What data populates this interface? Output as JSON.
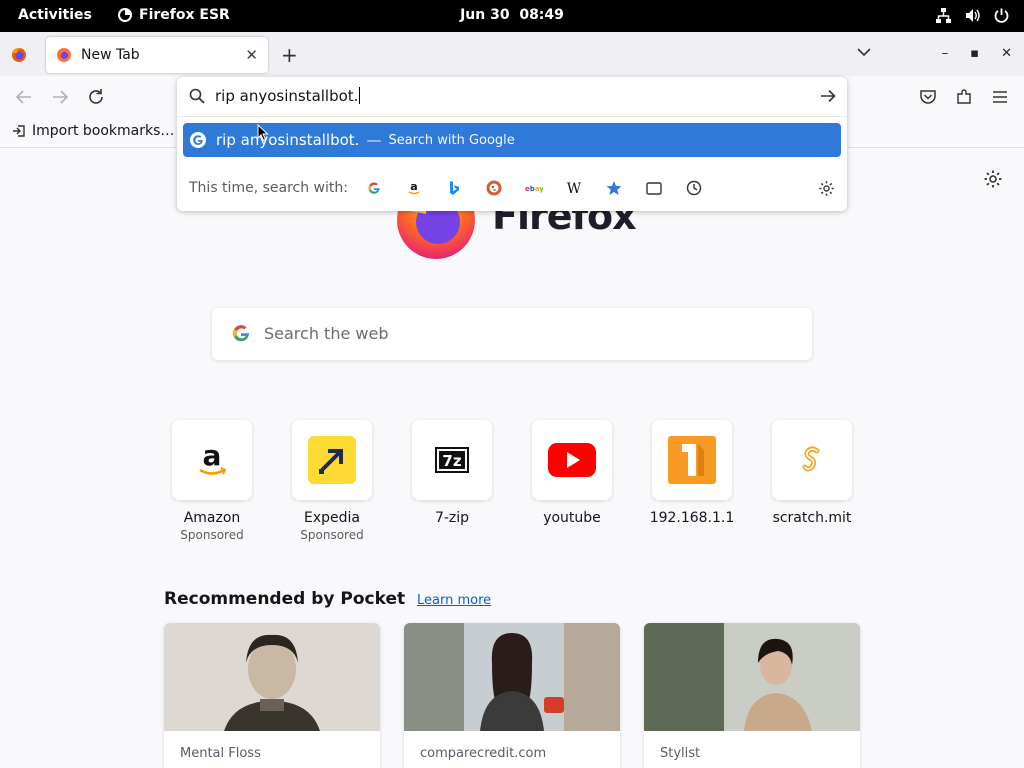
{
  "system_bar": {
    "activities": "Activities",
    "app_name": "Firefox ESR",
    "date": "Jun 30",
    "time": "08:49"
  },
  "tabs": [
    {
      "title": "New Tab",
      "active": true
    }
  ],
  "bookmarks_toolbar": {
    "import_label": "Import bookmarks…"
  },
  "urlbar": {
    "value": "rip anyosinstallbot.",
    "suggestion": {
      "query": "rip anyosinstallbot.",
      "separator": "—",
      "action": "Search with Google"
    },
    "oneoff_label": "This time, search with:",
    "oneoff_engines": [
      "google-icon",
      "amazon-icon",
      "bing-icon",
      "duckduckgo-icon",
      "ebay-icon",
      "wikipedia-icon",
      "bookmarks-icon",
      "tabs-icon",
      "history-icon"
    ]
  },
  "newtab": {
    "logo_text": "Firefox",
    "search_placeholder": "Search the web",
    "shortcuts": [
      {
        "title": "Amazon",
        "sponsored": "Sponsored",
        "icon": "amazon-icon"
      },
      {
        "title": "Expedia",
        "sponsored": "Sponsored",
        "icon": "expedia-icon"
      },
      {
        "title": "7-zip",
        "sponsored": "",
        "icon": "7zip-icon"
      },
      {
        "title": "youtube",
        "sponsored": "",
        "icon": "youtube-icon"
      },
      {
        "title": "192.168.1.1",
        "sponsored": "",
        "icon": "letter-1-icon"
      },
      {
        "title": "scratch.mit",
        "sponsored": "",
        "icon": "scratch-icon"
      }
    ],
    "pocket": {
      "heading": "Recommended by Pocket",
      "learn_more": "Learn more",
      "cards": [
        {
          "source": "Mental Floss"
        },
        {
          "source": "comparecredit.com"
        },
        {
          "source": "Stylist"
        }
      ]
    }
  },
  "colors": {
    "accent": "#2f7ad8",
    "link": "#0061e0",
    "page_bg": "#f9f9fb"
  }
}
